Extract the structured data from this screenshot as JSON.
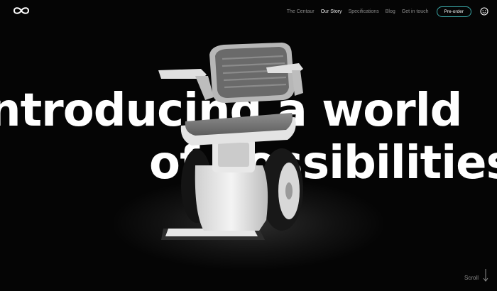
{
  "nav": {
    "links": [
      "The Centaur",
      "Our Story",
      "Specifications",
      "Blog",
      "Get in touch"
    ],
    "preorder_label": "Pre-order"
  },
  "hero": {
    "line1": "ntroducing a world",
    "line2": "of possibilities"
  },
  "scroll_label": "Scroll",
  "colors": {
    "background": "#050505",
    "accent": "#3aa6a6",
    "nav_inactive": "#8d8d8d"
  },
  "icons": {
    "logo": "infinity-logo-icon",
    "menu": "smiley-menu-icon",
    "scroll": "arrow-down-icon"
  }
}
